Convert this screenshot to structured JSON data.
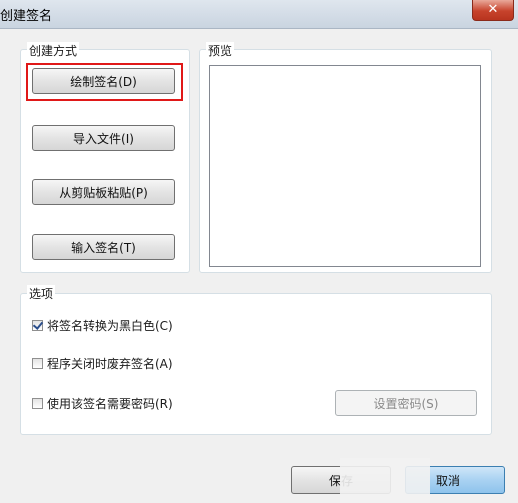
{
  "window": {
    "title": "创建签名",
    "close_glyph": "✕"
  },
  "creation_method": {
    "label": "创建方式",
    "buttons": [
      {
        "label": "绘制签名(D)"
      },
      {
        "label": "导入文件(I)"
      },
      {
        "label": "从剪贴板粘贴(P)"
      },
      {
        "label": "输入签名(T)"
      }
    ],
    "highlight_color": "#e01818"
  },
  "preview": {
    "label": "预览"
  },
  "options": {
    "label": "选项",
    "items": [
      {
        "label": "将签名转换为黑白色(C)",
        "checked": true
      },
      {
        "label": "程序关闭时废弃签名(A)",
        "checked": false
      },
      {
        "label": "使用该签名需要密码(R)",
        "checked": false
      }
    ],
    "set_password_label": "设置密码(S)"
  },
  "footer": {
    "save_label": "保存",
    "cancel_label": "取消"
  }
}
